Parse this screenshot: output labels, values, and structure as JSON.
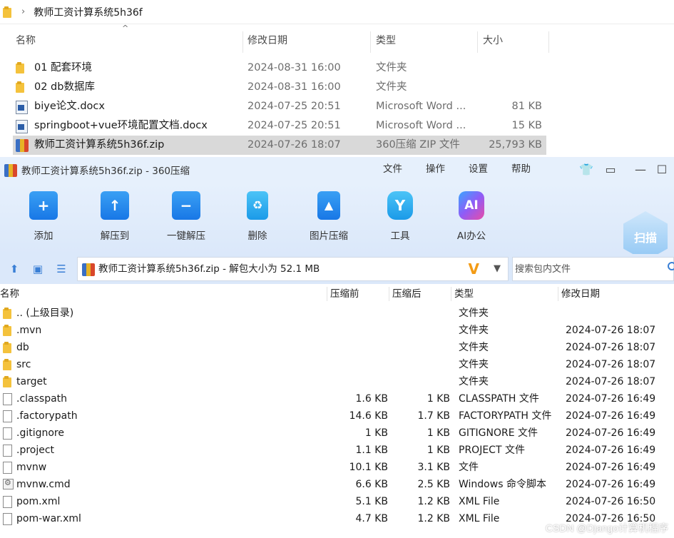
{
  "explorer": {
    "breadcrumb": "教师工资计算系统5h36f",
    "columns": {
      "name": "名称",
      "modified": "修改日期",
      "type": "类型",
      "size": "大小"
    },
    "rows": [
      {
        "name": "01 配套环境",
        "modified": "2024-08-31 16:00",
        "type": "文件夹",
        "size": "",
        "icon": "folder-icon"
      },
      {
        "name": "02 db数据库",
        "modified": "2024-08-31 16:00",
        "type": "文件夹",
        "size": "",
        "icon": "folder-icon"
      },
      {
        "name": "biye论文.docx",
        "modified": "2024-07-25 20:51",
        "type": "Microsoft Word ...",
        "size": "81 KB",
        "icon": "word-doc-icon"
      },
      {
        "name": "springboot+vue环境配置文档.docx",
        "modified": "2024-07-25 20:51",
        "type": "Microsoft Word ...",
        "size": "15 KB",
        "icon": "word-doc-icon"
      },
      {
        "name": "教师工资计算系统5h36f.zip",
        "modified": "2024-07-26 18:07",
        "type": "360压缩 ZIP 文件",
        "size": "25,793 KB",
        "icon": "zip-file-icon",
        "selected": true
      }
    ]
  },
  "zip_window": {
    "title": "教师工资计算系统5h36f.zip - 360压缩",
    "menu": [
      "文件",
      "操作",
      "设置",
      "帮助"
    ],
    "toolbar": [
      {
        "label": "添加",
        "icon": "add-folder-icon"
      },
      {
        "label": "解压到",
        "icon": "extract-to-icon"
      },
      {
        "label": "一键解压",
        "icon": "one-click-extract-icon"
      },
      {
        "label": "删除",
        "icon": "recycle-bin-icon"
      },
      {
        "label": "图片压缩",
        "icon": "image-compress-icon"
      },
      {
        "label": "工具",
        "icon": "tools-icon"
      },
      {
        "label": "AI办公",
        "icon": "ai-office-icon"
      }
    ],
    "scan_label": "扫描",
    "path_text": "教师工资计算系统5h36f.zip - 解包大小为 52.1 MB",
    "search_placeholder": "搜索包内文件",
    "columns": {
      "name": "名称",
      "compressed_before": "压缩前",
      "compressed_after": "压缩后",
      "type": "类型",
      "modified": "修改日期"
    },
    "rows": [
      {
        "name": ".. (上级目录)",
        "before": "",
        "after": "",
        "type": "文件夹",
        "modified": "",
        "icon": "folder-icon"
      },
      {
        "name": ".mvn",
        "before": "",
        "after": "",
        "type": "文件夹",
        "modified": "2024-07-26 18:07",
        "icon": "folder-icon"
      },
      {
        "name": "db",
        "before": "",
        "after": "",
        "type": "文件夹",
        "modified": "2024-07-26 18:07",
        "icon": "folder-icon"
      },
      {
        "name": "src",
        "before": "",
        "after": "",
        "type": "文件夹",
        "modified": "2024-07-26 18:07",
        "icon": "folder-icon"
      },
      {
        "name": "target",
        "before": "",
        "after": "",
        "type": "文件夹",
        "modified": "2024-07-26 18:07",
        "icon": "folder-icon"
      },
      {
        "name": ".classpath",
        "before": "1.6 KB",
        "after": "1 KB",
        "type": "CLASSPATH 文件",
        "modified": "2024-07-26 16:49",
        "icon": "file-icon"
      },
      {
        "name": ".factorypath",
        "before": "14.6 KB",
        "after": "1.7 KB",
        "type": "FACTORYPATH 文件",
        "modified": "2024-07-26 16:49",
        "icon": "file-icon"
      },
      {
        "name": ".gitignore",
        "before": "1 KB",
        "after": "1 KB",
        "type": "GITIGNORE 文件",
        "modified": "2024-07-26 16:49",
        "icon": "file-icon"
      },
      {
        "name": ".project",
        "before": "1.1 KB",
        "after": "1 KB",
        "type": "PROJECT 文件",
        "modified": "2024-07-26 16:49",
        "icon": "file-icon"
      },
      {
        "name": "mvnw",
        "before": "10.1 KB",
        "after": "3.1 KB",
        "type": "文件",
        "modified": "2024-07-26 16:49",
        "icon": "file-icon"
      },
      {
        "name": "mvnw.cmd",
        "before": "6.6 KB",
        "after": "2.5 KB",
        "type": "Windows 命令脚本",
        "modified": "2024-07-26 16:49",
        "icon": "cmd-script-icon"
      },
      {
        "name": "pom.xml",
        "before": "5.1 KB",
        "after": "1.2 KB",
        "type": "XML File",
        "modified": "2024-07-26 16:50",
        "icon": "file-icon"
      },
      {
        "name": "pom-war.xml",
        "before": "4.7 KB",
        "after": "1.2 KB",
        "type": "XML File",
        "modified": "2024-07-26 16:50",
        "icon": "file-icon"
      }
    ]
  },
  "watermark": "CSDN @Django计算机程序"
}
